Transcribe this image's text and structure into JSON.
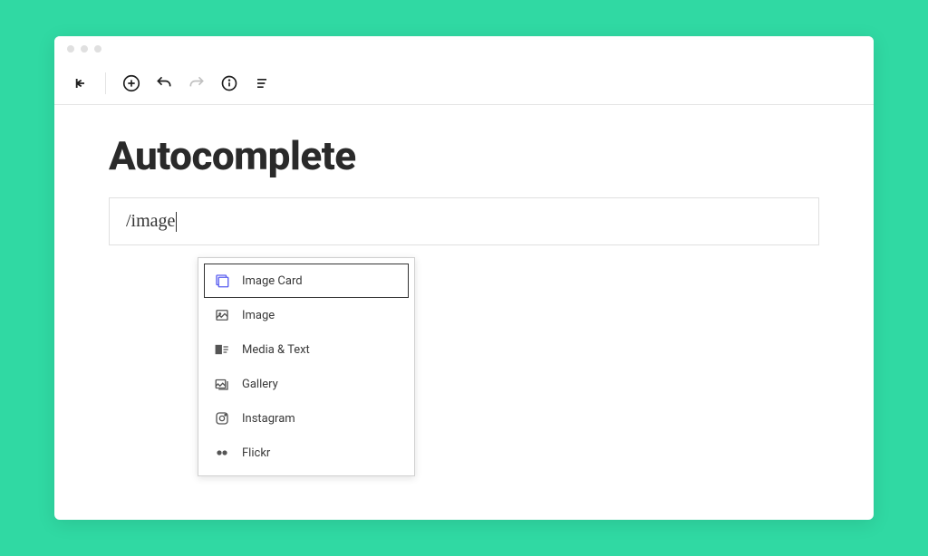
{
  "title": "Autocomplete",
  "block_input": "/image",
  "autocomplete": {
    "items": [
      {
        "label": "Image Card",
        "icon": "image-card",
        "selected": true
      },
      {
        "label": "Image",
        "icon": "image",
        "selected": false
      },
      {
        "label": "Media & Text",
        "icon": "media-text",
        "selected": false
      },
      {
        "label": "Gallery",
        "icon": "gallery",
        "selected": false
      },
      {
        "label": "Instagram",
        "icon": "instagram",
        "selected": false
      },
      {
        "label": "Flickr",
        "icon": "flickr",
        "selected": false
      }
    ]
  }
}
